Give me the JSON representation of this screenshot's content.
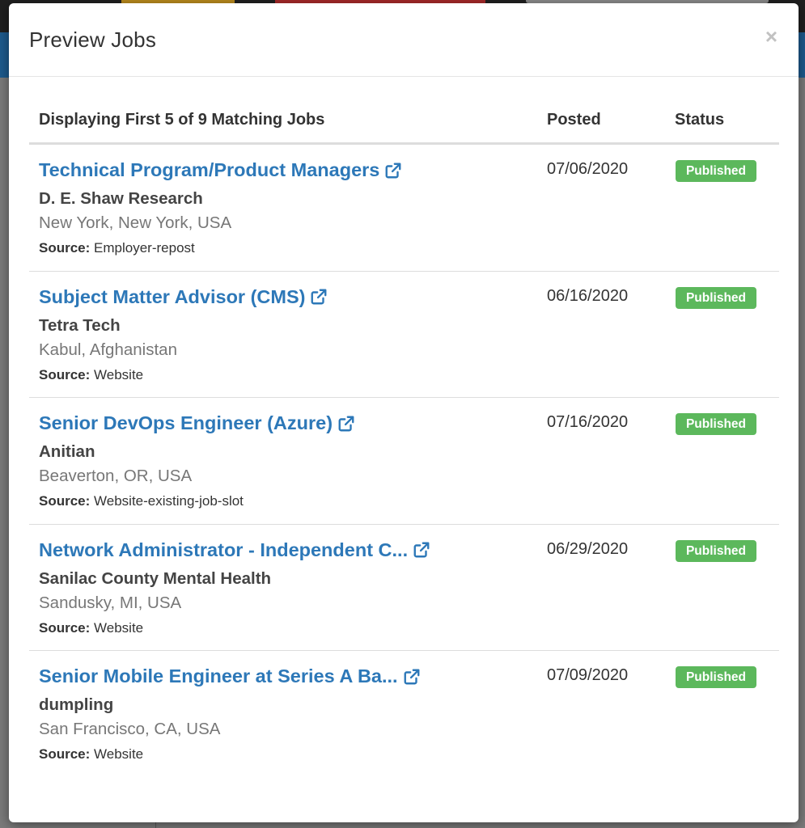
{
  "modal": {
    "title": "Preview Jobs",
    "close_label": "×"
  },
  "table": {
    "headers": {
      "title": "Displaying First 5 of 9 Matching Jobs",
      "posted": "Posted",
      "status": "Status"
    },
    "source_label": "Source:",
    "rows": [
      {
        "title": "Technical Program/Product Managers",
        "company": "D. E. Shaw Research",
        "location": "New York, New York, USA",
        "source": "Employer-repost",
        "posted": "07/06/2020",
        "status": "Published"
      },
      {
        "title": "Subject Matter Advisor (CMS)",
        "company": "Tetra Tech",
        "location": "Kabul, Afghanistan",
        "source": "Website",
        "posted": "06/16/2020",
        "status": "Published"
      },
      {
        "title": "Senior DevOps Engineer (Azure)",
        "company": "Anitian",
        "location": "Beaverton, OR, USA",
        "source": "Website-existing-job-slot",
        "posted": "07/16/2020",
        "status": "Published"
      },
      {
        "title": "Network Administrator - Independent C...",
        "company": "Sanilac County Mental Health",
        "location": "Sandusky, MI, USA",
        "source": "Website",
        "posted": "06/29/2020",
        "status": "Published"
      },
      {
        "title": "Senior Mobile Engineer at Series A Ba...",
        "company": "dumpling",
        "location": "San Francisco, CA, USA",
        "source": "Website",
        "posted": "07/09/2020",
        "status": "Published"
      }
    ]
  },
  "colors": {
    "link": "#2d78b8",
    "status_published": "#5cb85c",
    "navbar": "#1d5a8c"
  },
  "icons": {
    "external_link": "external-link-icon",
    "close": "close-icon"
  }
}
